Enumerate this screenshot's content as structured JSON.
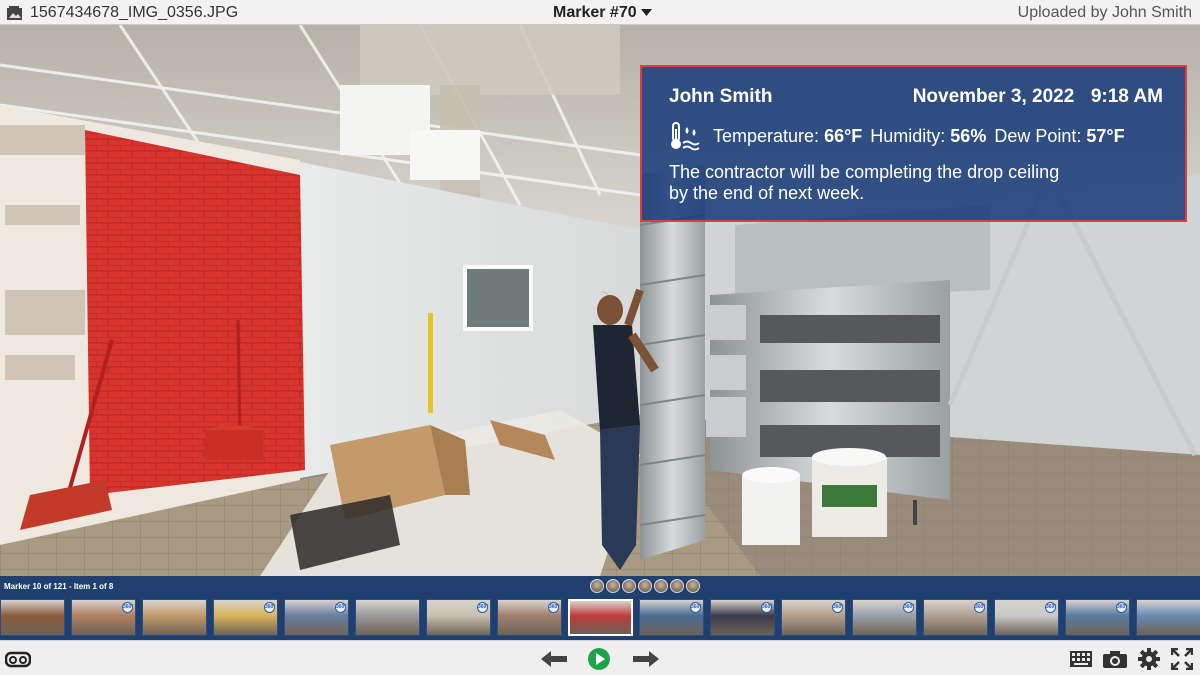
{
  "header": {
    "file_name": "1567434678_IMG_0356.JPG",
    "marker_label": "Marker #70",
    "uploaded_by": "Uploaded by John Smith"
  },
  "icons": {
    "file": "photo-file-icon",
    "marker_dropdown": "caret-down-icon",
    "weather": "thermometer-humidity-icon",
    "vr": "vr-goggles-icon",
    "prev": "arrow-left-icon",
    "play": "play-icon",
    "next": "arrow-right-icon",
    "keyboard": "keyboard-icon",
    "camera": "camera-icon",
    "settings": "gear-icon",
    "fullscreen": "fullscreen-icon"
  },
  "info_card": {
    "author": "John Smith",
    "date": "November 3, 2022",
    "time": "9:18 AM",
    "temperature_label": "Temperature:",
    "temperature_value": "66°F",
    "humidity_label": "Humidity:",
    "humidity_value": "56%",
    "dew_point_label": "Dew Point:",
    "dew_point_value": "57°F",
    "note": "The contractor will be completing the drop ceiling\nby the end of  next week."
  },
  "filmstrip": {
    "counter": "Marker 10 of 121 - Item 1 of 8",
    "dot_count": 7,
    "badge_text": "360°",
    "thumbnails": [
      {
        "tone": "#8a5a3a",
        "badge": false
      },
      {
        "tone": "#b08060",
        "badge": true
      },
      {
        "tone": "#c29a6a",
        "badge": false
      },
      {
        "tone": "#d9b25a",
        "badge": true
      },
      {
        "tone": "#6a7da0",
        "badge": true
      },
      {
        "tone": "#9a9a9a",
        "badge": false
      },
      {
        "tone": "#c8c0b0",
        "badge": true
      },
      {
        "tone": "#a08070",
        "badge": true
      },
      {
        "tone": "#c03a3a",
        "badge": false,
        "selected": true
      },
      {
        "tone": "#4a6a90",
        "badge": true
      },
      {
        "tone": "#3a3a4a",
        "badge": true
      },
      {
        "tone": "#b4a08a",
        "badge": true
      },
      {
        "tone": "#9aa0a8",
        "badge": true
      },
      {
        "tone": "#b0a090",
        "badge": true
      },
      {
        "tone": "#c8c8c8",
        "badge": true
      },
      {
        "tone": "#5a7aa0",
        "badge": true
      },
      {
        "tone": "#6a8ab0",
        "badge": false
      }
    ]
  },
  "colors": {
    "accent_play": "#1fa34a",
    "card_border": "#e23b3b",
    "card_bg": "#163a78",
    "filmstrip_bg": "#1f3f6e"
  }
}
